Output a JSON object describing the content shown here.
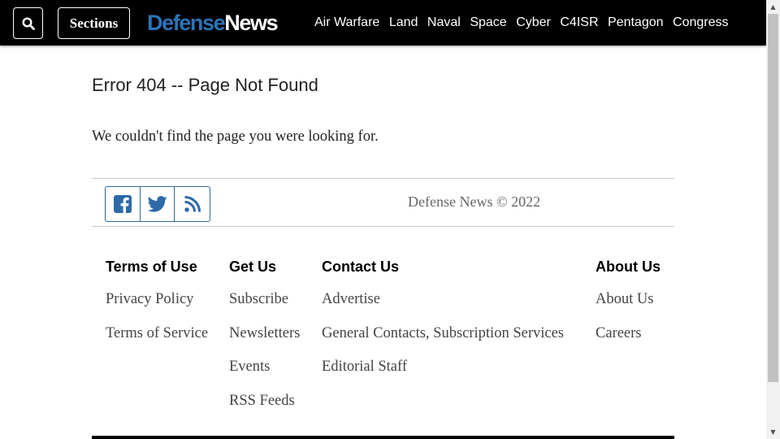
{
  "header": {
    "sections_label": "Sections",
    "logo": {
      "part1": "Defense",
      "part2": "News"
    },
    "nav": [
      "Air Warfare",
      "Land",
      "Naval",
      "Space",
      "Cyber",
      "C4ISR",
      "Pentagon",
      "Congress"
    ]
  },
  "main": {
    "title": "Error 404 -- Page Not Found",
    "message": "We couldn't find the page you were looking for."
  },
  "footer": {
    "copyright": "Defense News © 2022",
    "social": [
      "facebook-icon",
      "twitter-icon",
      "rss-icon"
    ],
    "columns": [
      {
        "heading": "Terms of Use",
        "links": [
          "Privacy Policy",
          "Terms of Service"
        ]
      },
      {
        "heading": "Get Us",
        "links": [
          "Subscribe",
          "Newsletters",
          "Events",
          "RSS Feeds"
        ]
      },
      {
        "heading": "Contact Us",
        "links": [
          "Advertise",
          "General Contacts, Subscription Services",
          "Editorial Staff"
        ]
      },
      {
        "heading": "About Us",
        "links": [
          "About Us",
          "Careers"
        ]
      }
    ]
  },
  "colors": {
    "header_bg": "#000000",
    "brand_blue": "#2b74b8",
    "social_blue": "#2e6aa8"
  }
}
